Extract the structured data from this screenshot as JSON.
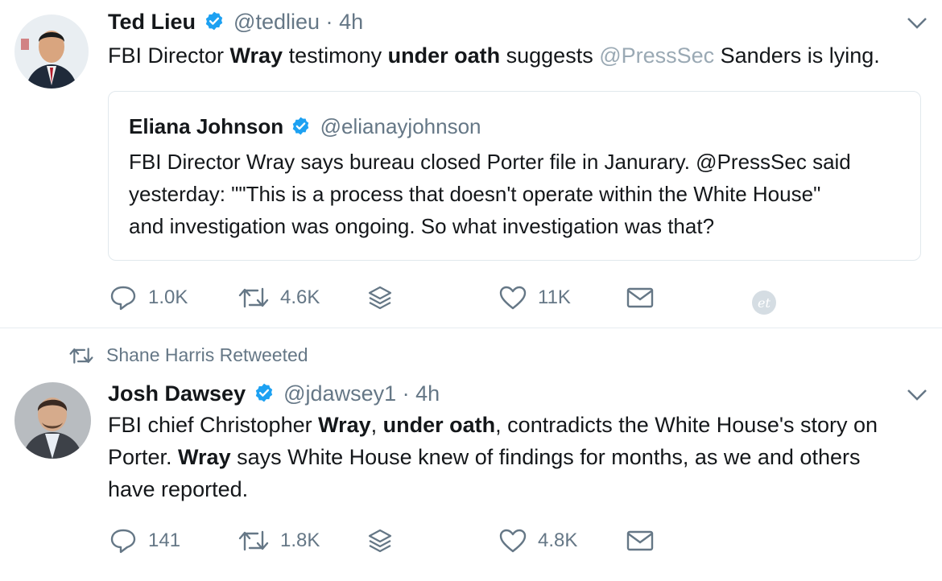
{
  "tweet1": {
    "name": "Ted Lieu",
    "handle": "@tedlieu",
    "separator": "·",
    "time": "4h",
    "text": {
      "t1": "FBI Director ",
      "b1": "Wray",
      "t2": " testimony ",
      "b2": "under oath",
      "t3": " suggests ",
      "mention": "@PressSec",
      "t4": " Sanders is lying."
    },
    "quote": {
      "name": "Eliana Johnson",
      "handle": "@elianayjohnson",
      "line1": "FBI Director Wray says bureau closed Porter file in Janurary. @PressSec said",
      "line2": "yesterday: \"\"This is a process that doesn't operate within the White House\"",
      "line3": "and investigation was ongoing. So what investigation was that?"
    },
    "actions": {
      "replies": "1.0K",
      "retweets": "4.6K",
      "likes": "11K"
    }
  },
  "tweet2": {
    "retweeted_by": "Shane Harris Retweeted",
    "name": "Josh Dawsey",
    "handle": "@jdawsey1",
    "separator": "·",
    "time": "4h",
    "text": {
      "t1": "FBI chief Christopher ",
      "b1": "Wray",
      "t2": ", ",
      "b2": "under oath",
      "t3": ", contradicts the White House's story on",
      "b3": "Wray",
      "t4": " says White House knew of findings for months, as we and others",
      "line2_start": "Porter. ",
      "line3": "have reported."
    },
    "actions": {
      "replies": "141",
      "retweets": "1.8K",
      "likes": "4.8K"
    }
  },
  "colors": {
    "verified": "#1da1f2",
    "muted": "#657786",
    "border": "#e1e8ed"
  }
}
